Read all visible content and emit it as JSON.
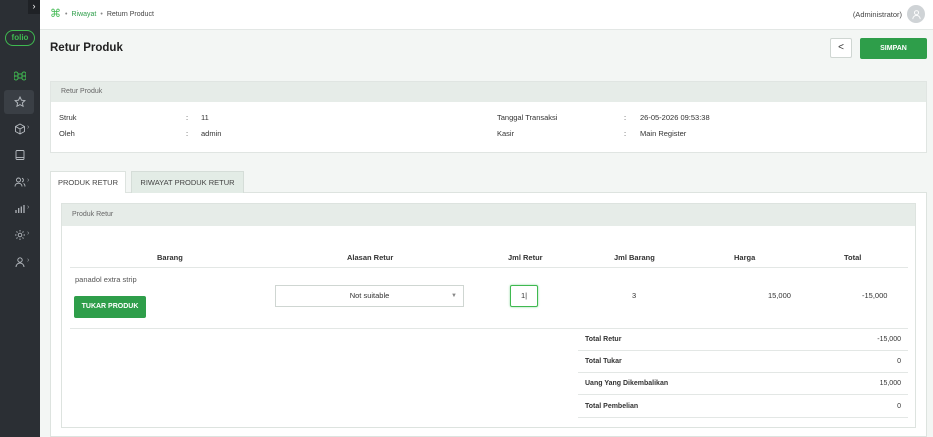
{
  "sidebar": {
    "toggle": "›",
    "logo": "folio",
    "icons": [
      "command-icon",
      "star-icon",
      "box-icon",
      "book-icon",
      "users-icon",
      "chart-icon",
      "settings-icon",
      "user-icon"
    ]
  },
  "topbar": {
    "breadcrumb": {
      "home_icon": "⌘",
      "riwayat": "Riwayat",
      "current": "Return Product"
    },
    "user": "(Administrator)"
  },
  "header": {
    "title": "Retur Produk",
    "back": "<",
    "save": "SIMPAN"
  },
  "info": {
    "section": "Retur Produk",
    "struk_label": "Struk",
    "struk_value": "11",
    "oleh_label": "Oleh",
    "oleh_value": "admin",
    "tanggal_label": "Tanggal Transaksi",
    "tanggal_value": "26-05-2026 09:53:38",
    "kasir_label": "Kasir",
    "kasir_value": "Main Register",
    "colon": ":"
  },
  "tabs": {
    "tab1": "PRODUK RETUR",
    "tab2": "RIWAYAT PRODUK RETUR"
  },
  "retur": {
    "section": "Produk Retur",
    "columns": {
      "barang": "Barang",
      "alasan": "Alasan Retur",
      "jml_retur": "Jml Retur",
      "jml_barang": "Jml Barang",
      "harga": "Harga",
      "total": "Total"
    },
    "row": {
      "barang": "panadol extra strip",
      "swap_button": "TUKAR PRODUK",
      "alasan": "Not suitable",
      "jml_retur": "1|",
      "jml_barang": "3",
      "harga": "15,000",
      "total": "-15,000"
    },
    "summary": {
      "total_retur_label": "Total Retur",
      "total_retur": "-15,000",
      "total_tukar_label": "Total Tukar",
      "total_tukar": "0",
      "uang_label": "Uang Yang Dikembalikan",
      "uang": "15,000",
      "pembelian_label": "Total Pembelian",
      "pembelian": "0"
    }
  },
  "colors": {
    "accent": "#2e9e4a",
    "sidebar": "#2b2f34"
  }
}
